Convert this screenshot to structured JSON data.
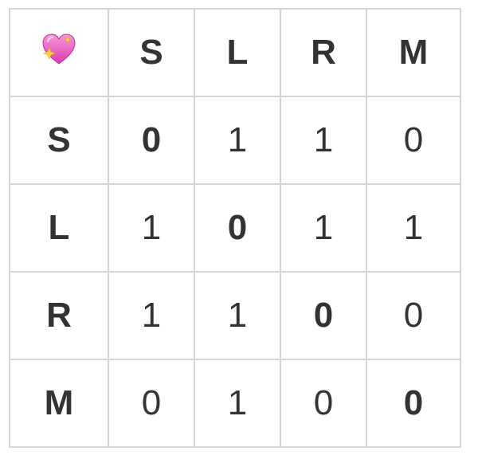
{
  "corner": {
    "icon": "sparkling-heart-icon",
    "icon_color": "#e04ec0"
  },
  "header": [
    "S",
    "L",
    "R",
    "M"
  ],
  "rows": [
    {
      "label": "S",
      "values": [
        "0",
        "1",
        "1",
        "0"
      ]
    },
    {
      "label": "L",
      "values": [
        "1",
        "0",
        "1",
        "1"
      ]
    },
    {
      "label": "R",
      "values": [
        "1",
        "1",
        "0",
        "0"
      ]
    },
    {
      "label": "M",
      "values": [
        "0",
        "1",
        "0",
        "0"
      ]
    }
  ],
  "colors": {
    "diagonal": "#e03a2a",
    "value": "#333333",
    "label": "#000000",
    "grid": "#d4d4d4"
  }
}
